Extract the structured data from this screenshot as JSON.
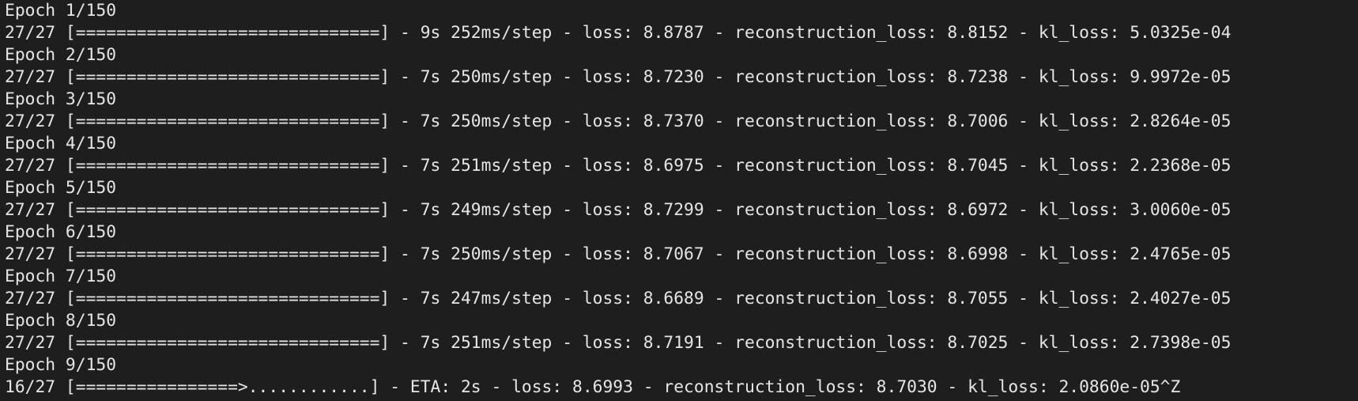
{
  "terminal": {
    "lines": [
      "Epoch 1/150",
      "27/27 [==============================] - 9s 252ms/step - loss: 8.8787 - reconstruction_loss: 8.8152 - kl_loss: 5.0325e-04",
      "Epoch 2/150",
      "27/27 [==============================] - 7s 250ms/step - loss: 8.7230 - reconstruction_loss: 8.7238 - kl_loss: 9.9972e-05",
      "Epoch 3/150",
      "27/27 [==============================] - 7s 250ms/step - loss: 8.7370 - reconstruction_loss: 8.7006 - kl_loss: 2.8264e-05",
      "Epoch 4/150",
      "27/27 [==============================] - 7s 251ms/step - loss: 8.6975 - reconstruction_loss: 8.7045 - kl_loss: 2.2368e-05",
      "Epoch 5/150",
      "27/27 [==============================] - 7s 249ms/step - loss: 8.7299 - reconstruction_loss: 8.6972 - kl_loss: 3.0060e-05",
      "Epoch 6/150",
      "27/27 [==============================] - 7s 250ms/step - loss: 8.7067 - reconstruction_loss: 8.6998 - kl_loss: 2.4765e-05",
      "Epoch 7/150",
      "27/27 [==============================] - 7s 247ms/step - loss: 8.6689 - reconstruction_loss: 8.7055 - kl_loss: 2.4027e-05",
      "Epoch 8/150",
      "27/27 [==============================] - 7s 251ms/step - loss: 8.7191 - reconstruction_loss: 8.7025 - kl_loss: 2.7398e-05",
      "Epoch 9/150",
      "16/27 [================>............] - ETA: 2s - loss: 8.6993 - reconstruction_loss: 8.7030 - kl_loss: 2.0860e-05^Z"
    ]
  },
  "colors": {
    "background": "#1e1e1e",
    "text": "#e6e6e6"
  }
}
